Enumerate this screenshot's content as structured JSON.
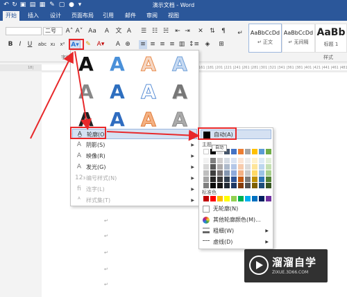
{
  "title_bar": {
    "title": "演示文档 - Word"
  },
  "tabs": [
    {
      "label": "开始",
      "active": true
    },
    {
      "label": "插入"
    },
    {
      "label": "设计"
    },
    {
      "label": "页面布局"
    },
    {
      "label": "引用"
    },
    {
      "label": "邮件"
    },
    {
      "label": "审阅"
    },
    {
      "label": "视图"
    }
  ],
  "ribbon": {
    "font_size": "二号",
    "styles": [
      {
        "sample": "AaBbCcDd",
        "name": "↵ 正文"
      },
      {
        "sample": "AaBbCcDd",
        "name": "↵ 无间隔"
      },
      {
        "sample": "AaBb",
        "name": "标题 1"
      }
    ],
    "styles_group_label": "样式",
    "font_group_label": "字体"
  },
  "ruler_text": "161 |181 |201 |221 |241 |261 |281 |301 |321 |341 |361 |381 |401 |421 |441 |461 |481",
  "ruler_left_text": "18|",
  "text_effects_menu": {
    "items": [
      {
        "label": "轮廓(O)",
        "icon": "outline-icon",
        "submenu": true,
        "highlighted": true
      },
      {
        "label": "阴影(S)",
        "icon": "shadow-icon",
        "submenu": true
      },
      {
        "label": "映像(R)",
        "icon": "reflection-icon",
        "submenu": true
      },
      {
        "label": "发光(G)",
        "icon": "glow-icon",
        "submenu": true
      },
      {
        "label": "编号样式(N)",
        "icon": "number-style-icon",
        "submenu": true,
        "disabled": true
      },
      {
        "label": "连字(L)",
        "icon": "ligature-icon",
        "submenu": true,
        "disabled": true
      },
      {
        "label": "样式集(T)",
        "icon": "stylistic-set-icon",
        "submenu": true,
        "disabled": true
      }
    ],
    "gallery_glyph": "A"
  },
  "outline_submenu": {
    "auto_label": "自动(A)",
    "tooltip": "自动",
    "theme_label": "主题",
    "standard_label": "标准色",
    "no_outline_label": "无轮廓(N)",
    "more_colors_label": "其他轮廓颜色(M)...",
    "weight_label": "粗细(W)",
    "dash_label": "虚线(D)"
  },
  "watermark": {
    "title": "溜溜自学",
    "url": "ZIXUE.3D66.COM"
  },
  "colors": {
    "accent": "#2b579a",
    "annotation_red": "#e8282a",
    "standard": [
      "#c00000",
      "#ff0000",
      "#ffc000",
      "#ffff00",
      "#92d050",
      "#00b050",
      "#00b0f0",
      "#0070c0",
      "#002060",
      "#7030a0"
    ]
  }
}
